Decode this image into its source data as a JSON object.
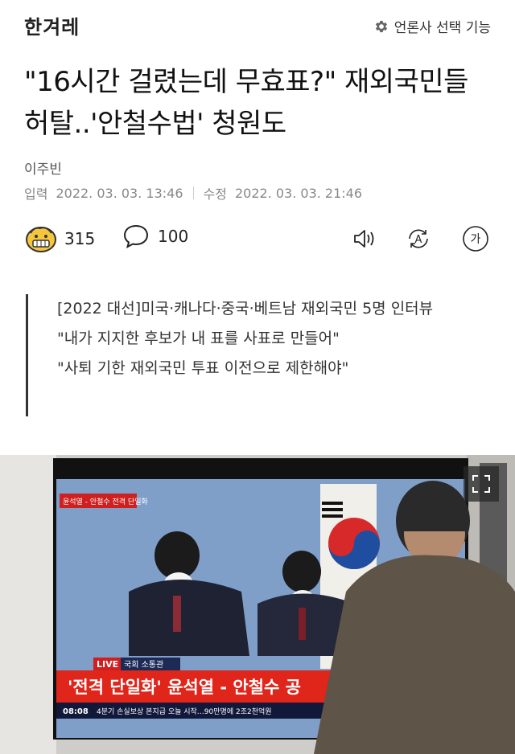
{
  "header": {
    "logo": "한겨레",
    "press_select_label": "언론사 선택 기능",
    "icons": {
      "press_select": "gear-icon"
    }
  },
  "article": {
    "title": "\"16시간 걸렸는데 무효표?\" 재외국민들 허탈..'안철수법' 청원도",
    "author": "이주빈",
    "published_label": "입력",
    "published_value": "2022. 03. 03. 13:46",
    "modified_label": "수정",
    "modified_value": "2022. 03. 03. 21:46"
  },
  "actions": {
    "reaction_count": "315",
    "comment_count": "100",
    "icons": {
      "reaction": "emoji-reaction-icon",
      "comment": "speech-bubble-icon",
      "listen": "speaker-icon",
      "translate": "translate-icon",
      "font": "font-size-icon"
    },
    "font_glyph": "가",
    "translate_glyph": "A"
  },
  "summary": {
    "lines": [
      "[2022 대선]미국·캐나다·중국·베트남 재외국민 5명 인터뷰",
      "\"내가 지지한 후보가 내 표를 사표로 만들어\"",
      "\"사퇴 기한 재외국민 투표 이전으로 제한해야\""
    ]
  },
  "photo": {
    "tv_tag": "윤석열 - 안철수 전격 단일화",
    "live_label": "LIVE",
    "live_venue": "국회 소통관",
    "headline": "'전격 단일화' 윤석열 - 안철수 공",
    "ticker_time": "08:08",
    "ticker_text": "4분기 손실보상 본지급 오늘 시작…90만명에 2조2천억원",
    "icons": {
      "expand": "expand-icon"
    }
  },
  "colors": {
    "text": "#111111",
    "muted": "#888888",
    "summary_bar": "#333333",
    "tv_headline_bg": "#e0251b",
    "tv_tag_bg": "#cf1f1f"
  }
}
